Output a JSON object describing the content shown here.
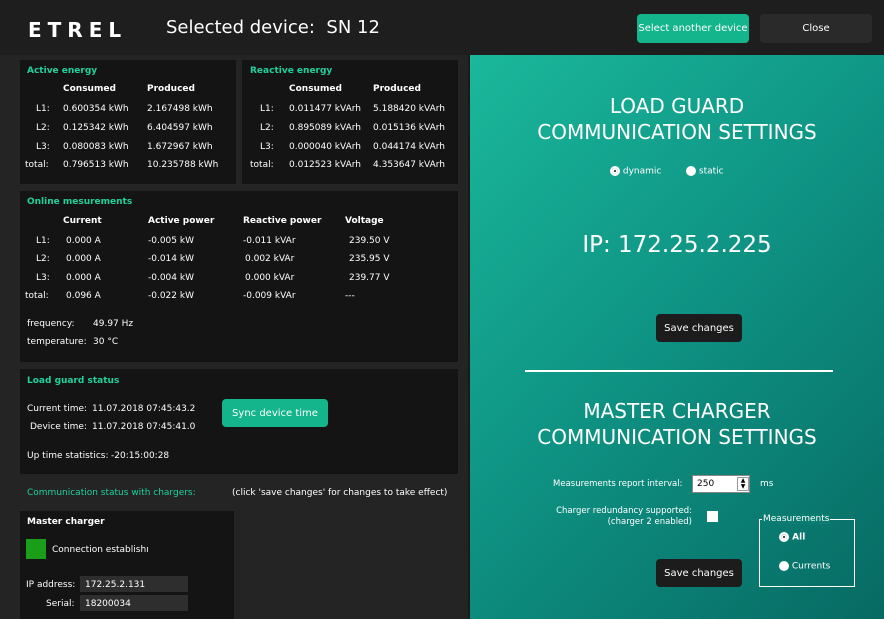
{
  "header": {
    "logo": "ETREL",
    "title": "Selected device:",
    "device": "SN 12",
    "select_btn": "Select another device",
    "close_btn": "Close"
  },
  "active_energy": {
    "title": "Active energy",
    "col1": "Consumed",
    "col2": "Produced",
    "rows": [
      {
        "label": "L1:",
        "consumed": "0.600354 kWh",
        "produced": "2.167498 kWh"
      },
      {
        "label": "L2:",
        "consumed": "0.125342 kWh",
        "produced": "6.404597 kWh"
      },
      {
        "label": "L3:",
        "consumed": "0.080083 kWh",
        "produced": "1.672967 kWh"
      },
      {
        "label": "total:",
        "consumed": "0.796513 kWh",
        "produced": "10.235788 kWh"
      }
    ]
  },
  "reactive_energy": {
    "title": "Reactive energy",
    "col1": "Consumed",
    "col2": "Produced",
    "rows": [
      {
        "label": "L1:",
        "consumed": "0.011477 kVArh",
        "produced": "5.188420 kVArh"
      },
      {
        "label": "L2:",
        "consumed": "0.895089 kVArh",
        "produced": "0.015136 kVArh"
      },
      {
        "label": "L3:",
        "consumed": "0.000040 kVArh",
        "produced": "0.044174 kVArh"
      },
      {
        "label": "total:",
        "consumed": "0.012523 kVArh",
        "produced": "4.353647 kVArh"
      }
    ]
  },
  "online": {
    "title": "Online mesurements",
    "cols": [
      "Current",
      "Active power",
      "Reactive power",
      "Voltage"
    ],
    "rows": [
      {
        "label": "L1:",
        "current": "0.000 A",
        "active": "-0.005 kW",
        "reactive": "-0.011 kVAr",
        "voltage": "239.50 V"
      },
      {
        "label": "L2:",
        "current": "0.000 A",
        "active": "-0.014 kW",
        "reactive": "0.002 kVAr",
        "voltage": "235.95 V"
      },
      {
        "label": "L3:",
        "current": "0.000 A",
        "active": "-0.004 kW",
        "reactive": "0.000 kVAr",
        "voltage": "239.77 V"
      },
      {
        "label": "total:",
        "current": "0.096 A",
        "active": "-0.022 kW",
        "reactive": "-0.009 kVAr",
        "voltage": "---"
      }
    ],
    "frequency_label": "frequency:",
    "frequency": "49.97 Hz",
    "temperature_label": "temperature:",
    "temperature": "30 °C"
  },
  "load_guard": {
    "title": "Load guard status",
    "current_time_label": "Current time:",
    "current_time": "11.07.2018 07:45:43.2",
    "device_time_label": "Device time:",
    "device_time": "11.07.2018 07:45:41.0",
    "uptime_label": "Up time statistics:",
    "uptime": "-20:15:00:28",
    "sync_btn": "Sync device time"
  },
  "comm": {
    "title": "Communication status with chargers:",
    "note": "(click 'save changes' for changes to take effect)"
  },
  "master": {
    "title": "Master charger",
    "status": "Connection establishı",
    "status_color": "#1a9e1a",
    "ip_label": "IP address:",
    "ip": "172.25.2.131",
    "serial_label": "Serial:",
    "serial": "18200034"
  },
  "lg_settings": {
    "title1": "LOAD GUARD",
    "title2": "COMMUNICATION SETTINGS",
    "opt_dynamic": "dynamic",
    "opt_static": "static",
    "selected": "dynamic",
    "ip_label": "IP:",
    "ip": "172.25.2.225",
    "save": "Save changes"
  },
  "mc_settings": {
    "title1": "MASTER CHARGER",
    "title2": "COMMUNICATION SETTINGS",
    "interval_label": "Measurements report interval:",
    "interval_value": "250",
    "interval_unit": "ms",
    "redundancy_label1": "Charger redundancy supported:",
    "redundancy_label2": "(charger 2 enabled)",
    "redundancy_checked": false,
    "group_title": "Measurements",
    "opt_all": "All",
    "opt_currents": "Currents",
    "selected": "All",
    "save": "Save changes"
  }
}
